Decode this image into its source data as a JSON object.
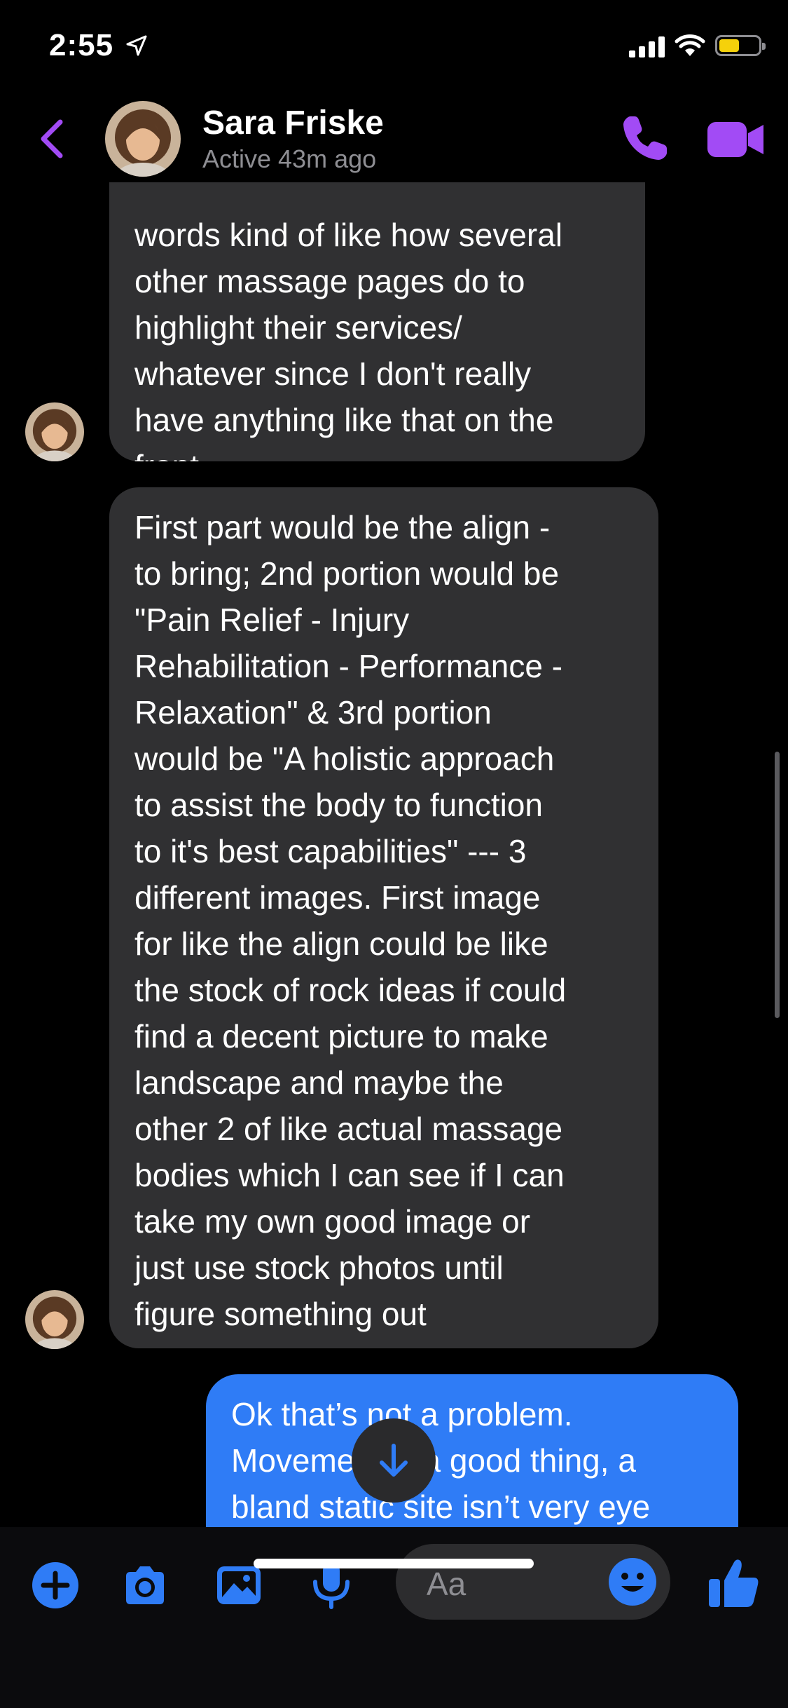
{
  "status_bar": {
    "time": "2:55"
  },
  "header": {
    "contact_name": "Sara Friske",
    "contact_status": "Active 43m ago"
  },
  "messages": [
    {
      "sender": "contact",
      "text": "other massage pages do to\nhighlight their services/\nwhatever since I don't really\nhave anything like that on the\nfront.",
      "clipped_top": "words kind of like how several"
    },
    {
      "sender": "contact",
      "text": "First part would be the align -\nto bring; 2nd portion would be\n\"Pain Relief - Injury\nRehabilitation - Performance -\nRelaxation\" & 3rd portion\nwould be \"A holistic approach\nto assist the body to function\nto it's best capabilities\" --- 3\ndifferent images.  First image\nfor like the align could be like\nthe stock of rock ideas if could\nfind a decent picture to make\nlandscape and maybe the\nother 2 of like actual massage\nbodies which I can see if I can\ntake my own good image or\njust use stock photos until\nfigure something out"
    },
    {
      "sender": "me",
      "text": "Ok that’s not a problem.\nMovement is a good thing, a\nbland static site isn’t very eye"
    }
  ],
  "composer": {
    "placeholder": "Aa"
  },
  "colors": {
    "accent_purple": "#a24bf5",
    "accent_blue": "#2f7cf6",
    "incoming_bubble": "#303032",
    "battery": "#f5d10b"
  },
  "icons": {
    "status": [
      "location-arrow-icon",
      "signal-icon",
      "wifi-icon",
      "battery-icon"
    ],
    "header": [
      "back-chevron-icon",
      "phone-icon",
      "video-camera-icon"
    ],
    "composer": [
      "plus-icon",
      "camera-icon",
      "photo-icon",
      "microphone-icon",
      "emoji-icon",
      "thumbs-up-icon"
    ],
    "overlay": [
      "arrow-down-icon"
    ]
  }
}
